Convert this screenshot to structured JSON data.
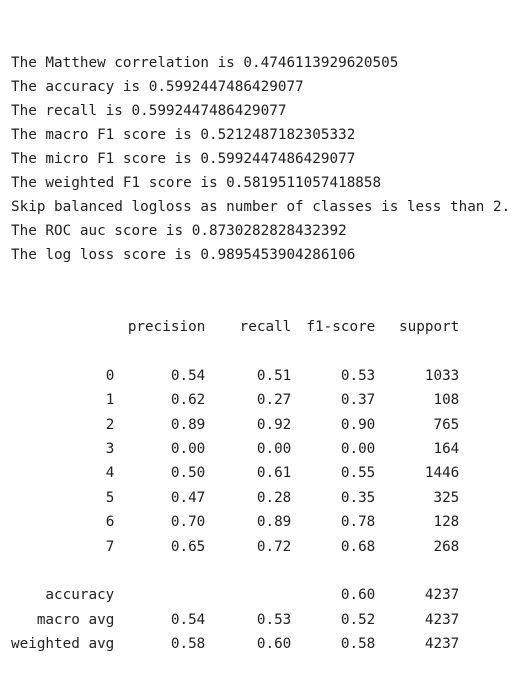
{
  "metrics_lines": [
    "The Matthew correlation is 0.4746113929620505",
    "The accuracy is 0.5992447486429077",
    "The recall is 0.5992447486429077",
    "The macro F1 score is 0.5212487182305332",
    "The micro F1 score is 0.5992447486429077",
    "The weighted F1 score is 0.5819511057418858",
    "Skip balanced logloss as number of classes is less than 2.",
    "The ROC auc score is 0.8730282828432392",
    "The log loss score is 0.9895453904286106"
  ],
  "report": {
    "headers": [
      "",
      "precision",
      "recall",
      "f1-score",
      "support"
    ],
    "class_rows": [
      [
        "0",
        "0.54",
        "0.51",
        "0.53",
        "1033"
      ],
      [
        "1",
        "0.62",
        "0.27",
        "0.37",
        "108"
      ],
      [
        "2",
        "0.89",
        "0.92",
        "0.90",
        "765"
      ],
      [
        "3",
        "0.00",
        "0.00",
        "0.00",
        "164"
      ],
      [
        "4",
        "0.50",
        "0.61",
        "0.55",
        "1446"
      ],
      [
        "5",
        "0.47",
        "0.28",
        "0.35",
        "325"
      ],
      [
        "6",
        "0.70",
        "0.89",
        "0.78",
        "128"
      ],
      [
        "7",
        "0.65",
        "0.72",
        "0.68",
        "268"
      ]
    ],
    "summary_rows": [
      [
        "accuracy",
        "",
        "",
        "0.60",
        "4237"
      ],
      [
        "macro avg",
        "0.54",
        "0.53",
        "0.52",
        "4237"
      ],
      [
        "weighted avg",
        "0.58",
        "0.60",
        "0.58",
        "4237"
      ]
    ]
  }
}
